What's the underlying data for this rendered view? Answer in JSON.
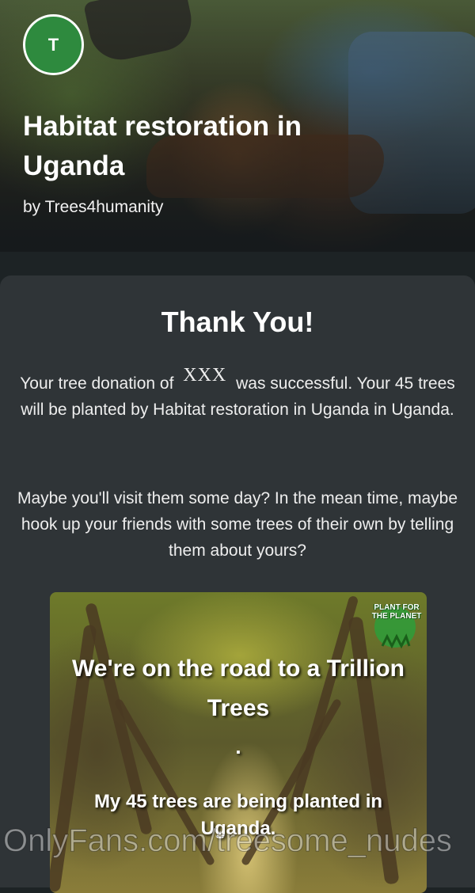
{
  "header": {
    "avatar_letter": "T",
    "title": "Habitat restoration in Uganda",
    "byline": "by Trees4humanity"
  },
  "card": {
    "heading": "Thank You!",
    "donation_prefix": "Your tree donation of ",
    "donation_amount": "XXX",
    "donation_suffix": " was successful. Your 45 trees will be planted by Habitat restoration in Uganda in Uganda.",
    "followup": "Maybe you'll visit them some day? In the mean time, maybe hook up your friends with some trees of their own by telling them about yours?"
  },
  "share_image": {
    "logo_text": "PLANT FOR THE PLANET",
    "logo_color": "#2e9e3a",
    "headline": "We're on the road to a Trillion Trees",
    "dot": ".",
    "subline": "My 45 trees are being planted in Uganda."
  },
  "watermark": "OnlyFans.com/treesome_nudes",
  "colors": {
    "background": "#1d2325",
    "card": "#2f3437",
    "avatar": "#2e8a3e"
  }
}
